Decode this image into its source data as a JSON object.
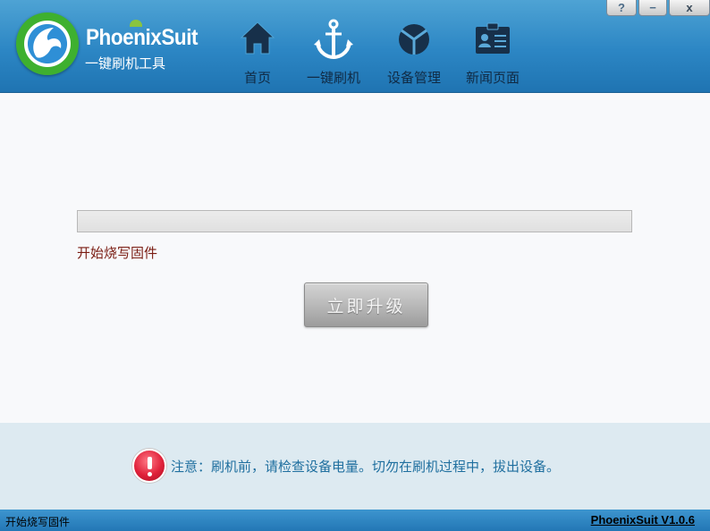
{
  "app": {
    "name_prefix": "Phoenix",
    "name_suffix": "Suit",
    "subtitle": "一键刷机工具"
  },
  "nav": {
    "items": [
      {
        "label": "首页",
        "icon": "home-icon"
      },
      {
        "label": "一键刷机",
        "icon": "anchor-icon"
      },
      {
        "label": "设备管理",
        "icon": "device-manage-icon"
      },
      {
        "label": "新闻页面",
        "icon": "news-card-icon"
      }
    ],
    "active_index": 1
  },
  "window_controls": {
    "help": "?",
    "minimize": "−",
    "close": "x"
  },
  "main": {
    "progress_fraction": 0,
    "status_text": "开始烧写固件",
    "upgrade_button": "立即升级"
  },
  "notice": {
    "text": "注意：刷机前，请检查设备电量。切勿在刷机过程中，拔出设备。",
    "icon": "warning-icon"
  },
  "statusbar": {
    "left_text": "开始烧写固件",
    "version": "PhoenixSuit V1.0.6"
  },
  "colors": {
    "header": "#2c86c4",
    "status_text": "#7a1c12",
    "notice_text": "#1f6f9f",
    "notice_bg": "#ddeaf1"
  }
}
